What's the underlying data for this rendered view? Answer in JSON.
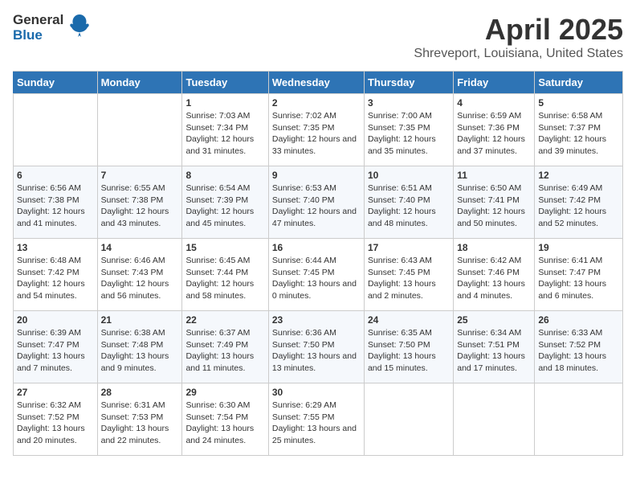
{
  "logo": {
    "general": "General",
    "blue": "Blue"
  },
  "title": "April 2025",
  "subtitle": "Shreveport, Louisiana, United States",
  "days_of_week": [
    "Sunday",
    "Monday",
    "Tuesday",
    "Wednesday",
    "Thursday",
    "Friday",
    "Saturday"
  ],
  "weeks": [
    [
      {
        "day": "",
        "info": ""
      },
      {
        "day": "",
        "info": ""
      },
      {
        "day": "1",
        "info": "Sunrise: 7:03 AM\nSunset: 7:34 PM\nDaylight: 12 hours and 31 minutes."
      },
      {
        "day": "2",
        "info": "Sunrise: 7:02 AM\nSunset: 7:35 PM\nDaylight: 12 hours and 33 minutes."
      },
      {
        "day": "3",
        "info": "Sunrise: 7:00 AM\nSunset: 7:35 PM\nDaylight: 12 hours and 35 minutes."
      },
      {
        "day": "4",
        "info": "Sunrise: 6:59 AM\nSunset: 7:36 PM\nDaylight: 12 hours and 37 minutes."
      },
      {
        "day": "5",
        "info": "Sunrise: 6:58 AM\nSunset: 7:37 PM\nDaylight: 12 hours and 39 minutes."
      }
    ],
    [
      {
        "day": "6",
        "info": "Sunrise: 6:56 AM\nSunset: 7:38 PM\nDaylight: 12 hours and 41 minutes."
      },
      {
        "day": "7",
        "info": "Sunrise: 6:55 AM\nSunset: 7:38 PM\nDaylight: 12 hours and 43 minutes."
      },
      {
        "day": "8",
        "info": "Sunrise: 6:54 AM\nSunset: 7:39 PM\nDaylight: 12 hours and 45 minutes."
      },
      {
        "day": "9",
        "info": "Sunrise: 6:53 AM\nSunset: 7:40 PM\nDaylight: 12 hours and 47 minutes."
      },
      {
        "day": "10",
        "info": "Sunrise: 6:51 AM\nSunset: 7:40 PM\nDaylight: 12 hours and 48 minutes."
      },
      {
        "day": "11",
        "info": "Sunrise: 6:50 AM\nSunset: 7:41 PM\nDaylight: 12 hours and 50 minutes."
      },
      {
        "day": "12",
        "info": "Sunrise: 6:49 AM\nSunset: 7:42 PM\nDaylight: 12 hours and 52 minutes."
      }
    ],
    [
      {
        "day": "13",
        "info": "Sunrise: 6:48 AM\nSunset: 7:42 PM\nDaylight: 12 hours and 54 minutes."
      },
      {
        "day": "14",
        "info": "Sunrise: 6:46 AM\nSunset: 7:43 PM\nDaylight: 12 hours and 56 minutes."
      },
      {
        "day": "15",
        "info": "Sunrise: 6:45 AM\nSunset: 7:44 PM\nDaylight: 12 hours and 58 minutes."
      },
      {
        "day": "16",
        "info": "Sunrise: 6:44 AM\nSunset: 7:45 PM\nDaylight: 13 hours and 0 minutes."
      },
      {
        "day": "17",
        "info": "Sunrise: 6:43 AM\nSunset: 7:45 PM\nDaylight: 13 hours and 2 minutes."
      },
      {
        "day": "18",
        "info": "Sunrise: 6:42 AM\nSunset: 7:46 PM\nDaylight: 13 hours and 4 minutes."
      },
      {
        "day": "19",
        "info": "Sunrise: 6:41 AM\nSunset: 7:47 PM\nDaylight: 13 hours and 6 minutes."
      }
    ],
    [
      {
        "day": "20",
        "info": "Sunrise: 6:39 AM\nSunset: 7:47 PM\nDaylight: 13 hours and 7 minutes."
      },
      {
        "day": "21",
        "info": "Sunrise: 6:38 AM\nSunset: 7:48 PM\nDaylight: 13 hours and 9 minutes."
      },
      {
        "day": "22",
        "info": "Sunrise: 6:37 AM\nSunset: 7:49 PM\nDaylight: 13 hours and 11 minutes."
      },
      {
        "day": "23",
        "info": "Sunrise: 6:36 AM\nSunset: 7:50 PM\nDaylight: 13 hours and 13 minutes."
      },
      {
        "day": "24",
        "info": "Sunrise: 6:35 AM\nSunset: 7:50 PM\nDaylight: 13 hours and 15 minutes."
      },
      {
        "day": "25",
        "info": "Sunrise: 6:34 AM\nSunset: 7:51 PM\nDaylight: 13 hours and 17 minutes."
      },
      {
        "day": "26",
        "info": "Sunrise: 6:33 AM\nSunset: 7:52 PM\nDaylight: 13 hours and 18 minutes."
      }
    ],
    [
      {
        "day": "27",
        "info": "Sunrise: 6:32 AM\nSunset: 7:52 PM\nDaylight: 13 hours and 20 minutes."
      },
      {
        "day": "28",
        "info": "Sunrise: 6:31 AM\nSunset: 7:53 PM\nDaylight: 13 hours and 22 minutes."
      },
      {
        "day": "29",
        "info": "Sunrise: 6:30 AM\nSunset: 7:54 PM\nDaylight: 13 hours and 24 minutes."
      },
      {
        "day": "30",
        "info": "Sunrise: 6:29 AM\nSunset: 7:55 PM\nDaylight: 13 hours and 25 minutes."
      },
      {
        "day": "",
        "info": ""
      },
      {
        "day": "",
        "info": ""
      },
      {
        "day": "",
        "info": ""
      }
    ]
  ]
}
